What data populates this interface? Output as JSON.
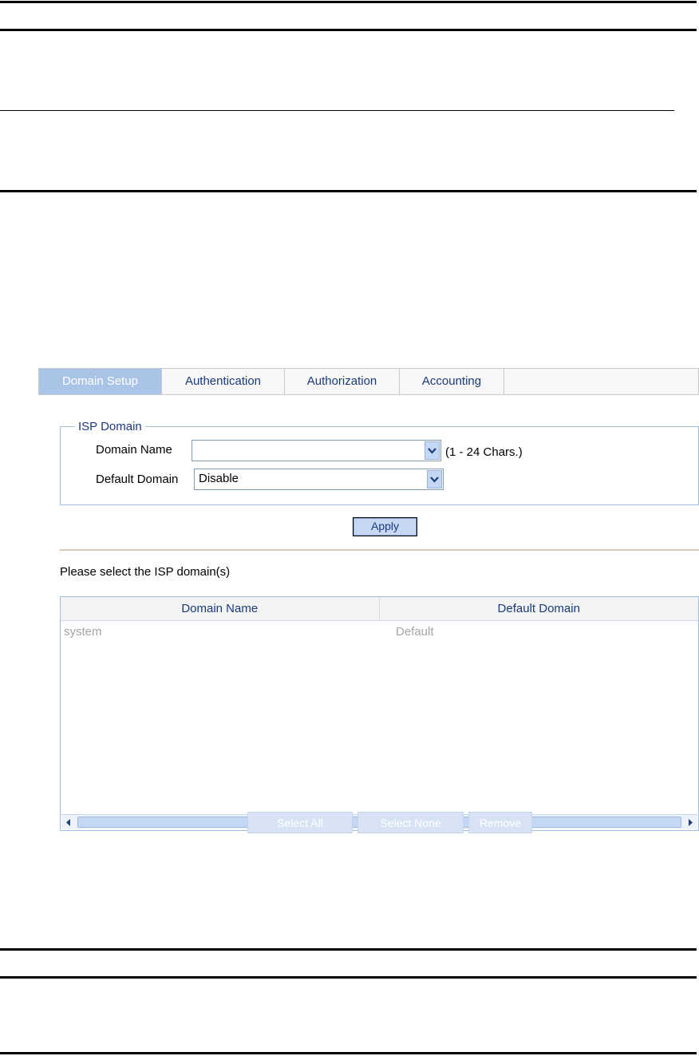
{
  "tabs": [
    {
      "label": "Domain Setup",
      "active": true
    },
    {
      "label": "Authentication",
      "active": false
    },
    {
      "label": "Authorization",
      "active": false
    },
    {
      "label": "Accounting",
      "active": false
    }
  ],
  "isp_domain": {
    "legend": "ISP Domain",
    "domain_name_label": "Domain Name",
    "domain_name_value": "",
    "domain_name_hint": "(1 - 24 Chars.)",
    "default_domain_label": "Default Domain",
    "default_domain_value": "Disable"
  },
  "apply_label": "Apply",
  "select_prompt": "Please select the ISP domain(s)",
  "table": {
    "columns": [
      "Domain Name",
      "Default Domain"
    ],
    "rows": [
      [
        "system",
        "Default"
      ]
    ]
  },
  "actions": {
    "select_all": "Select All",
    "select_none": "Select None",
    "remove": "Remove"
  },
  "colors": {
    "accent": "#a9c4e6",
    "link_text": "#1a3a7a"
  }
}
